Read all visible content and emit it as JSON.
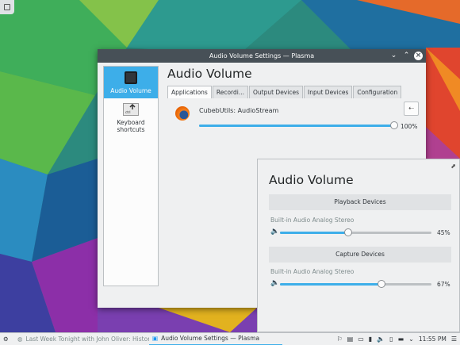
{
  "main_window": {
    "title": "Audio Volume Settings — Plasma",
    "sidebar": [
      {
        "label": "Audio Volume",
        "icon": "audio-volume-icon",
        "active": true
      },
      {
        "label": "Keyboard shortcuts",
        "icon": "keyboard-shortcuts-icon",
        "active": false
      }
    ],
    "heading": "Audio Volume",
    "tabs": [
      "Applications",
      "Recordi...",
      "Output Devices",
      "Input Devices",
      "Configuration"
    ],
    "active_tab": "Applications",
    "stream": {
      "name": "CubebUtils: AudioStream",
      "icon": "firefox-icon",
      "volume": 100,
      "volume_label": "100%"
    }
  },
  "popup": {
    "title": "Audio Volume",
    "playback_header": "Playback Devices",
    "playback_device": {
      "name": "Built-in Audio Analog Stereo",
      "volume": 45,
      "volume_label": "45%"
    },
    "capture_header": "Capture Devices",
    "capture_device": {
      "name": "Built-in Audio Analog Stereo",
      "volume": 67,
      "volume_label": "67%"
    }
  },
  "taskbar": {
    "tasks": [
      {
        "label": "Last Week Tonight with John Oliver: History L...",
        "active": false
      },
      {
        "label": "Audio Volume Settings — Plasma",
        "active": true
      }
    ],
    "clock": "11:55 PM"
  },
  "colors": {
    "accent": "#3daee9",
    "titlebar": "#475057",
    "window_bg": "#eff0f1"
  }
}
